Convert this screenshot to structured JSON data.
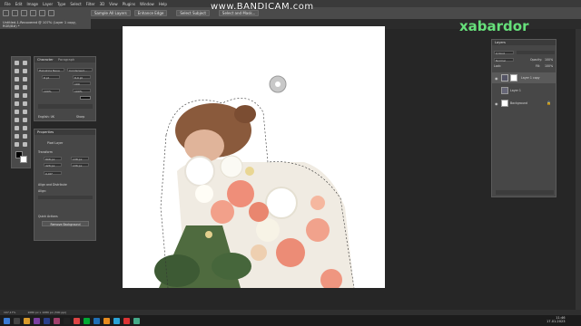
{
  "menu": [
    "File",
    "Edit",
    "Image",
    "Layer",
    "Type",
    "Select",
    "Filter",
    "3D",
    "View",
    "Plugins",
    "Window",
    "Help"
  ],
  "options": {
    "sample_all_layers": "Sample All Layers",
    "enhance_edge": "Enhance Edge",
    "select_subject": "Select Subject",
    "select_and_mask": "Select and Mask..."
  },
  "watermark": "www.BANDICAM.com",
  "brand": "xabardor",
  "doc_tab": "Untitled-1-Recovered @ 107% (Layer 1 copy, RGB/8#) *",
  "character": {
    "tab1": "Character",
    "tab2": "Paragraph",
    "font": "Helvetica Neue",
    "style": "Condensed...",
    "size": "8 pt",
    "leading": "8,9 pt",
    "tracking": "100",
    "scale_v": "100%",
    "scale_h": "100%",
    "lang": "English: UK",
    "aa": "Sharp"
  },
  "properties": {
    "title": "Properties",
    "subtitle": "Pixel Layer",
    "transform": "Transform",
    "w": "808 px",
    "h": "138 px",
    "x": "426 px",
    "y": "136 px",
    "angle": "0,00°",
    "align": "Align and Distribute",
    "align_sub": "Align:",
    "quick": "Quick Actions",
    "remove_bg": "Remove Background"
  },
  "layers": {
    "title": "Layers",
    "kind": "Q Kind",
    "mode": "Normal",
    "opacity_label": "Opacity:",
    "opacity": "100%",
    "lock": "Lock:",
    "fill_label": "Fill:",
    "fill": "100%",
    "items": [
      "Layer 1 copy",
      "Layer 1",
      "Background"
    ]
  },
  "status": "107,17%",
  "status_doc": "1080 px x 1080 px (300 ppi)",
  "time": "11:46",
  "date": "17.01.2023",
  "colors": {
    "accent": "#66e07a",
    "canvas": "#ffffff"
  }
}
